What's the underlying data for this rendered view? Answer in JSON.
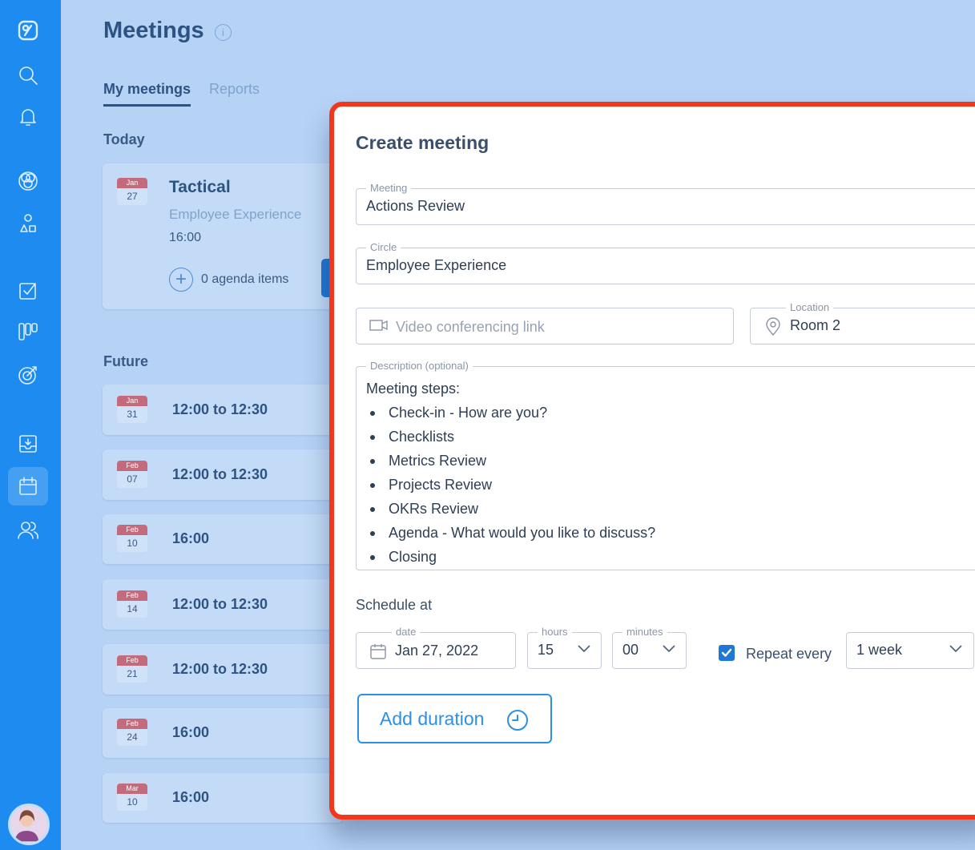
{
  "page": {
    "title": "Meetings"
  },
  "tabs": {
    "my_meetings": "My meetings",
    "reports": "Reports"
  },
  "sections": {
    "today": "Today",
    "future": "Future"
  },
  "today_card": {
    "month": "Jan",
    "day": "27",
    "title": "Tactical",
    "circle": "Employee Experience",
    "time": "16:00",
    "agenda": "0 agenda items"
  },
  "future_cards": [
    {
      "month": "Jan",
      "day": "31",
      "time": "12:00 to 12:30"
    },
    {
      "month": "Feb",
      "day": "07",
      "time": "12:00 to 12:30"
    },
    {
      "month": "Feb",
      "day": "10",
      "time": "16:00"
    },
    {
      "month": "Feb",
      "day": "14",
      "time": "12:00 to 12:30"
    },
    {
      "month": "Feb",
      "day": "21",
      "time": "12:00 to 12:30"
    },
    {
      "month": "Feb",
      "day": "24",
      "time": "16:00"
    },
    {
      "month": "Mar",
      "day": "10",
      "time": "16:00"
    }
  ],
  "modal": {
    "title": "Create meeting",
    "meeting": {
      "label": "Meeting",
      "value": "Actions Review"
    },
    "circle": {
      "label": "Circle",
      "value": "Employee Experience"
    },
    "video": {
      "placeholder": "Video conferencing link"
    },
    "location": {
      "label": "Location",
      "value": "Room 2"
    },
    "description": {
      "label": "Description (optional)",
      "heading": "Meeting steps:",
      "steps": [
        "Check-in - How are you?",
        "Checklists",
        "Metrics  Review",
        "Projects Review",
        "OKRs Review",
        "Agenda  - What would you like to discuss?",
        "Closing"
      ]
    },
    "schedule_label": "Schedule at",
    "date": {
      "label": "date",
      "value": "Jan 27, 2022"
    },
    "hours": {
      "label": "hours",
      "value": "15"
    },
    "minutes": {
      "label": "minutes",
      "value": "00"
    },
    "repeat_label": "Repeat every",
    "repeat_value": "1 week",
    "add_duration": "Add duration"
  }
}
